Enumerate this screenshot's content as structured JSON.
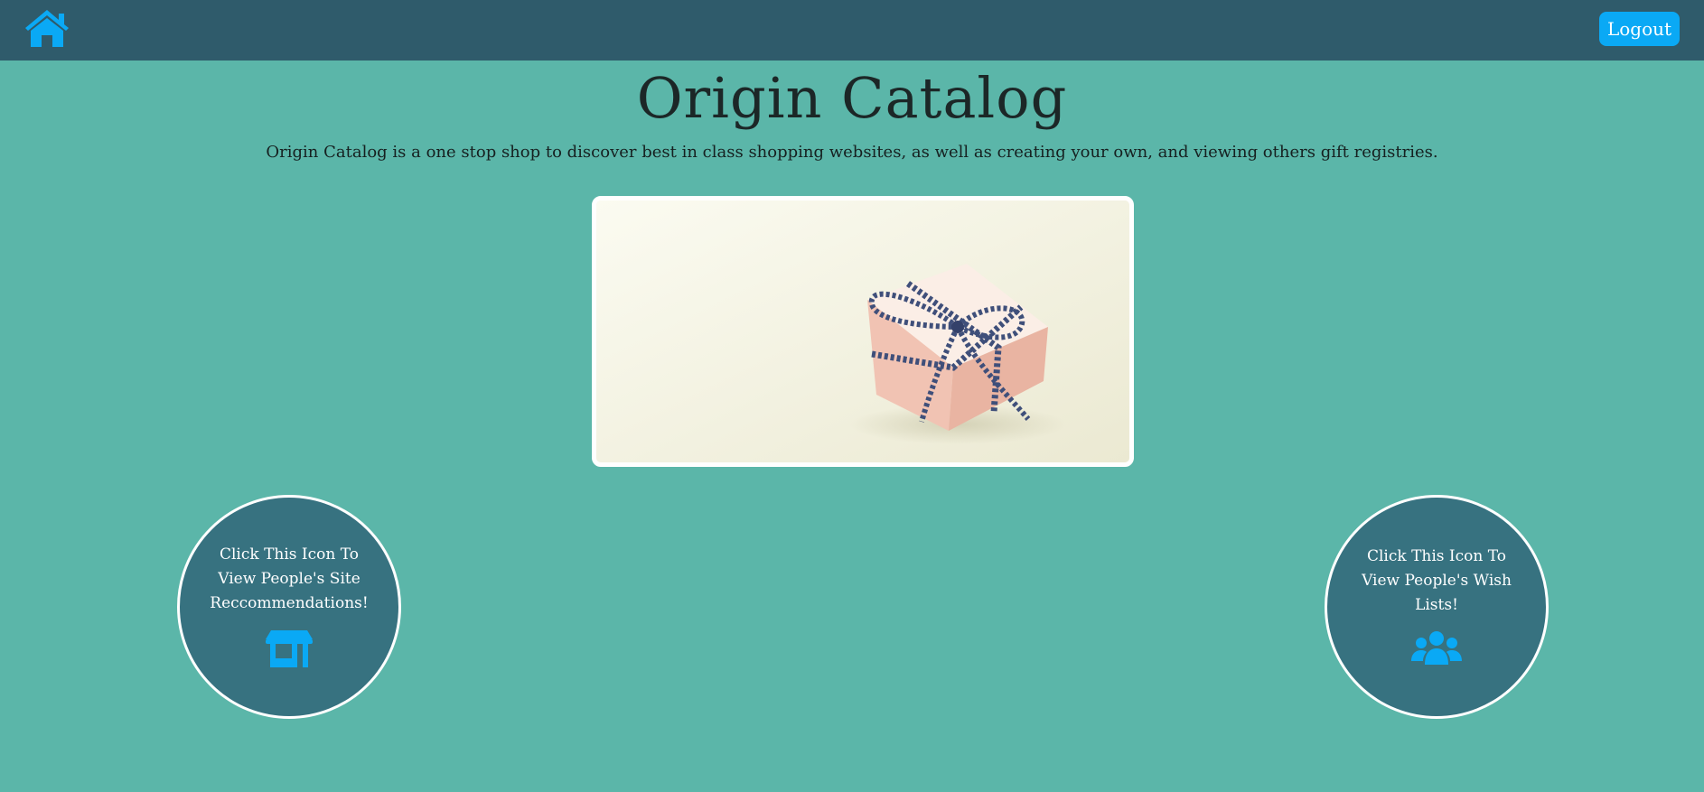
{
  "nav": {
    "home_icon": "home-icon",
    "logout_label": "Logout"
  },
  "main": {
    "title": "Origin Catalog",
    "description": "Origin Catalog is a one stop shop to discover best in class shopping websites, as well as creating your own, and viewing others gift registries."
  },
  "cards": {
    "sites_text": "Click This Icon To View People's Site Reccommendations!",
    "sites_icon": "store-icon",
    "wishlists_text": "Click This Icon To View People's Wish Lists!",
    "wishlists_icon": "users-icon"
  },
  "colors": {
    "background": "#5bb6a9",
    "navbar": "#2f5b6b",
    "accent": "#0aa9f5",
    "circle": "#377280"
  }
}
